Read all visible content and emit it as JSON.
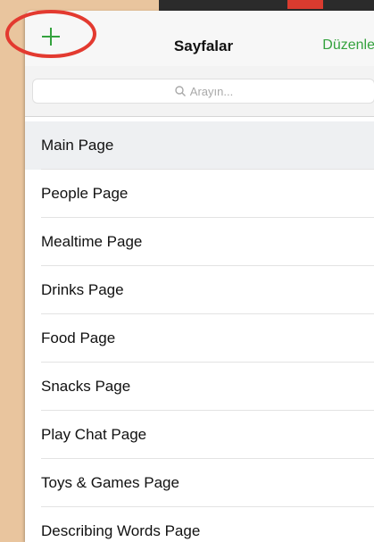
{
  "navbar": {
    "title": "Sayfalar",
    "edit_label": "Düzenle",
    "add_icon": "plus-icon"
  },
  "search": {
    "placeholder": "Arayın..."
  },
  "pages": [
    {
      "label": "Main Page"
    },
    {
      "label": "People Page"
    },
    {
      "label": "Mealtime Page"
    },
    {
      "label": "Drinks Page"
    },
    {
      "label": "Food Page"
    },
    {
      "label": "Snacks Page"
    },
    {
      "label": "Play Chat Page"
    },
    {
      "label": "Toys & Games Page"
    },
    {
      "label": "Describing Words Page"
    }
  ],
  "colors": {
    "accent": "#34a23e",
    "annotation": "#e33a30",
    "background": "#e9c59e"
  }
}
